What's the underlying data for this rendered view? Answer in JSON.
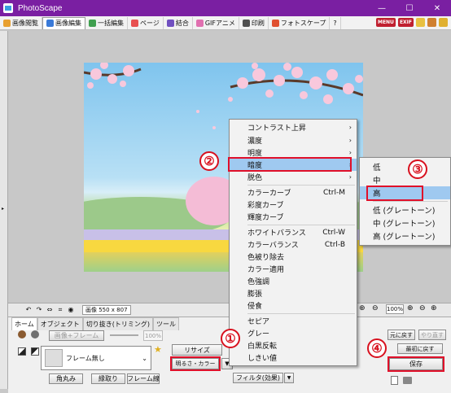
{
  "window": {
    "title": "PhotoScape",
    "min": "—",
    "max": "☐",
    "close": "✕"
  },
  "menu_tabs": [
    {
      "label": "画像閲覧",
      "color": "#e8a030"
    },
    {
      "label": "画像編集",
      "color": "#3a7ad8"
    },
    {
      "label": "一括編集",
      "color": "#40a050"
    },
    {
      "label": "ページ",
      "color": "#e85050"
    },
    {
      "label": "結合",
      "color": "#7050c0"
    },
    {
      "label": "GIFアニメ",
      "color": "#e070b0"
    },
    {
      "label": "印刷",
      "color": "#505050"
    },
    {
      "label": "フォトスケープ",
      "color": "#e05030"
    }
  ],
  "right_badges": {
    "menu": "MENU",
    "exif": "EXIF"
  },
  "toolbar": {
    "image_size": "画像 550 x 807",
    "zoom": "100%"
  },
  "panel": {
    "tabs": [
      "ホーム",
      "オブジェクト",
      "切り抜き(トリミング)",
      "ツール"
    ],
    "image_frame": "画像+フレーム",
    "percent": "100%",
    "frame_value": "フレーム無し",
    "round": "角丸み",
    "border": "縁取り",
    "frame_line": "フレーム線",
    "resize": "リサイズ",
    "brightness_color": "明るさ・カラー",
    "filter": "フィルタ(効果)",
    "undo": "元に戻す",
    "redo": "やり直す",
    "undo_all": "最初に戻す",
    "save": "保存"
  },
  "context_menu": [
    {
      "label": "コントラスト上昇",
      "arrow": "›"
    },
    {
      "label": "濃度",
      "arrow": "›"
    },
    {
      "label": "明度",
      "arrow": "›"
    },
    {
      "label": "暗度",
      "arrow": "›"
    },
    {
      "label": "脱色",
      "arrow": "›"
    },
    {
      "label": "カラーカーブ",
      "shortcut": "Ctrl-M"
    },
    {
      "label": "彩度カーブ"
    },
    {
      "label": "輝度カーブ"
    },
    {
      "label": "ホワイトバランス",
      "shortcut": "Ctrl-W"
    },
    {
      "label": "カラーバランス",
      "shortcut": "Ctrl-B"
    },
    {
      "label": "色被り除去"
    },
    {
      "label": "カラー適用"
    },
    {
      "label": "色強調"
    },
    {
      "label": "膨張"
    },
    {
      "label": "侵食"
    },
    {
      "label": "セピア"
    },
    {
      "label": "グレー"
    },
    {
      "label": "白黒反転"
    },
    {
      "label": "しきい値"
    }
  ],
  "submenu": [
    "低",
    "中",
    "高",
    "低 (グレートーン)",
    "中 (グレートーン)",
    "高 (グレートーン)"
  ],
  "steps": [
    "②",
    "③",
    "①",
    "④"
  ]
}
